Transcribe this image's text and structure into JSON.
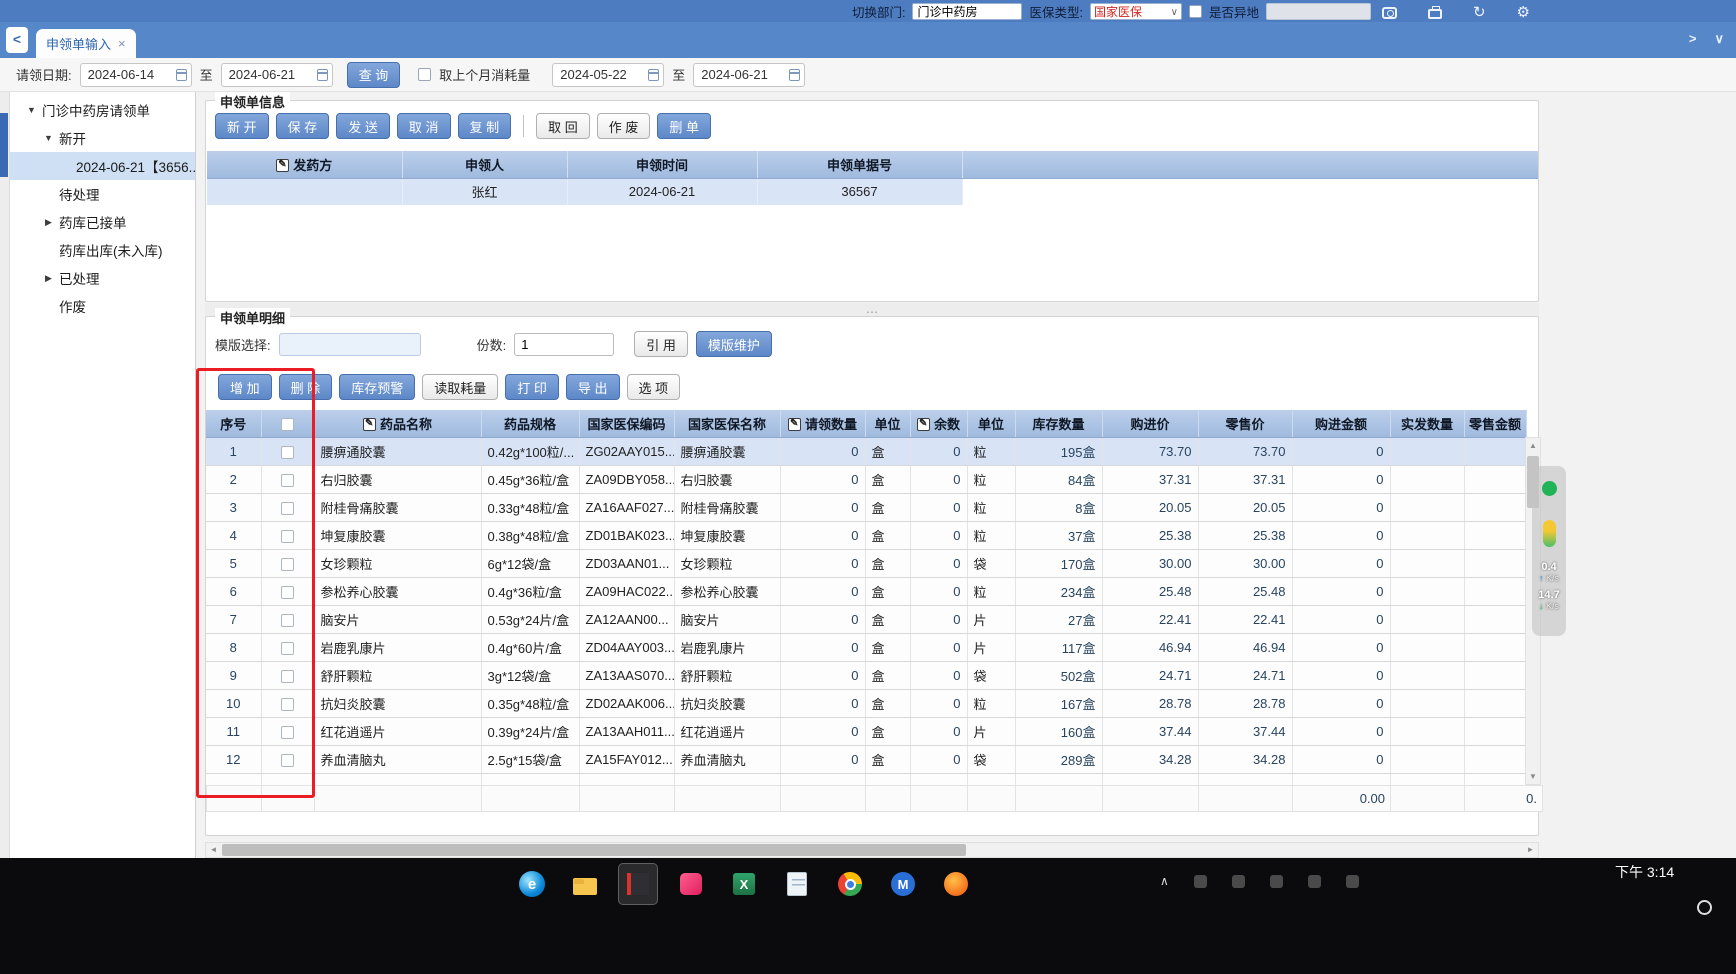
{
  "topbar": {
    "dept_label": "切换部门:",
    "dept_value": "门诊中药房",
    "insurance_label": "医保类型:",
    "insurance_value": "国家医保",
    "remote_label": "是否异地",
    "icons": [
      "screenshot-icon",
      "print-icon",
      "history-icon",
      "settings-gear-icon"
    ]
  },
  "tabbar": {
    "active_tab": "申领单输入"
  },
  "filterbar": {
    "date_label": "请领日期:",
    "date_from": "2024-06-14",
    "to_label": "至",
    "date_to": "2024-06-21",
    "query_button": "查 询",
    "consume_checkbox_label": "取上个月消耗量",
    "consume_from": "2024-05-22",
    "consume_to_label": "至",
    "consume_to": "2024-06-21"
  },
  "sidebar": {
    "items": [
      {
        "label": "门诊中药房请领单",
        "level": 0,
        "arrow": "down"
      },
      {
        "label": "新开",
        "level": 1,
        "arrow": "down"
      },
      {
        "label": "2024-06-21【3656...",
        "level": 2,
        "selected": true
      },
      {
        "label": "待处理",
        "level": 1
      },
      {
        "label": "药库已接单",
        "level": 1,
        "arrow": "right"
      },
      {
        "label": "药库出库(未入库)",
        "level": 1
      },
      {
        "label": "已处理",
        "level": 1,
        "arrow": "right"
      },
      {
        "label": "作废",
        "level": 1
      }
    ]
  },
  "info_section": {
    "title": "申领单信息",
    "buttons_primary": [
      "新 开",
      "保 存",
      "发 送",
      "取 消",
      "复 制"
    ],
    "buttons_secondary": [
      "取 回",
      "作 废"
    ],
    "button_delete": "删 单",
    "table": {
      "columns": [
        {
          "label": "发药方",
          "edit": true
        },
        {
          "label": "申领人"
        },
        {
          "label": "申领时间"
        },
        {
          "label": "申领单据号"
        }
      ],
      "row": [
        "",
        "张红",
        "2024-06-21",
        "36567"
      ]
    }
  },
  "detail_section": {
    "title": "申领单明细",
    "template_label": "模版选择:",
    "copies_label": "份数:",
    "copies_value": "1",
    "cite_button": "引 用",
    "template_maintain_button": "模版维护",
    "toolbar": {
      "add": "增 加",
      "delete": "删 除",
      "stock_warning": "库存预警",
      "read_usage": "读取耗量",
      "print": "打 印",
      "export": "导 出",
      "options": "选 项"
    }
  },
  "grid": {
    "columns": [
      {
        "label": "序号"
      },
      {
        "label": "",
        "checkbox": true
      },
      {
        "label": "药品名称",
        "edit": true
      },
      {
        "label": "药品规格"
      },
      {
        "label": "国家医保编码"
      },
      {
        "label": "国家医保名称"
      },
      {
        "label": "请领数量",
        "edit": true
      },
      {
        "label": "单位"
      },
      {
        "label": "余数",
        "edit": true
      },
      {
        "label": "单位"
      },
      {
        "label": "库存数量"
      },
      {
        "label": "购进价"
      },
      {
        "label": "零售价"
      },
      {
        "label": "购进金额"
      },
      {
        "label": "实发数量"
      },
      {
        "label": "零售金额"
      }
    ],
    "rows": [
      [
        "1",
        "腰痹通胶囊",
        "0.42g*100粒/...",
        "ZG02AAY015...",
        "腰痹通胶囊",
        "0",
        "盒",
        "0",
        "粒",
        "195盒",
        "73.70",
        "73.70",
        "0",
        "",
        ""
      ],
      [
        "2",
        "右归胶囊",
        "0.45g*36粒/盒",
        "ZA09DBY058...",
        "右归胶囊",
        "0",
        "盒",
        "0",
        "粒",
        "84盒",
        "37.31",
        "37.31",
        "0",
        "",
        ""
      ],
      [
        "3",
        "附桂骨痛胶囊",
        "0.33g*48粒/盒",
        "ZA16AAF027...",
        "附桂骨痛胶囊",
        "0",
        "盒",
        "0",
        "粒",
        "8盒",
        "20.05",
        "20.05",
        "0",
        "",
        ""
      ],
      [
        "4",
        "坤复康胶囊",
        "0.38g*48粒/盒",
        "ZD01BAK023...",
        "坤复康胶囊",
        "0",
        "盒",
        "0",
        "粒",
        "37盒",
        "25.38",
        "25.38",
        "0",
        "",
        ""
      ],
      [
        "5",
        "女珍颗粒",
        "6g*12袋/盒",
        "ZD03AAN01...",
        "女珍颗粒",
        "0",
        "盒",
        "0",
        "袋",
        "170盒",
        "30.00",
        "30.00",
        "0",
        "",
        ""
      ],
      [
        "6",
        "参松养心胶囊",
        "0.4g*36粒/盒",
        "ZA09HAC022...",
        "参松养心胶囊",
        "0",
        "盒",
        "0",
        "粒",
        "234盒",
        "25.48",
        "25.48",
        "0",
        "",
        ""
      ],
      [
        "7",
        "脑安片",
        "0.53g*24片/盒",
        "ZA12AAN00...",
        "脑安片",
        "0",
        "盒",
        "0",
        "片",
        "27盒",
        "22.41",
        "22.41",
        "0",
        "",
        ""
      ],
      [
        "8",
        "岩鹿乳康片",
        "0.4g*60片/盒",
        "ZD04AAY003...",
        "岩鹿乳康片",
        "0",
        "盒",
        "0",
        "片",
        "117盒",
        "46.94",
        "46.94",
        "0",
        "",
        ""
      ],
      [
        "9",
        "舒肝颗粒",
        "3g*12袋/盒",
        "ZA13AAS070...",
        "舒肝颗粒",
        "0",
        "盒",
        "0",
        "袋",
        "502盒",
        "24.71",
        "24.71",
        "0",
        "",
        ""
      ],
      [
        "10",
        "抗妇炎胶囊",
        "0.35g*48粒/盒",
        "ZD02AAK006...",
        "抗妇炎胶囊",
        "0",
        "盒",
        "0",
        "粒",
        "167盒",
        "28.78",
        "28.78",
        "0",
        "",
        ""
      ],
      [
        "11",
        "红花逍遥片",
        "0.39g*24片/盒",
        "ZA13AAH011...",
        "红花逍遥片",
        "0",
        "盒",
        "0",
        "片",
        "160盒",
        "37.44",
        "37.44",
        "0",
        "",
        ""
      ],
      [
        "12",
        "养血清脑丸",
        "2.5g*15袋/盒",
        "ZA15FAY012...",
        "养血清脑丸",
        "0",
        "盒",
        "0",
        "袋",
        "289盒",
        "34.28",
        "34.28",
        "0",
        "",
        ""
      ]
    ],
    "footer": {
      "purchase_amount_total": "0.00",
      "sell_amount_total": "0."
    }
  },
  "net_monitor": {
    "up_value": "0.4",
    "up_unit": "K/s",
    "down_value": "14.7",
    "down_unit": "K/s"
  },
  "taskbar": {
    "icons": [
      "windows-logo",
      "edge-browser",
      "file-explorer",
      "his-app-active",
      "pink-app",
      "excel",
      "notepad",
      "chrome",
      "m-app",
      "security-app"
    ],
    "time": "下午 3:14"
  }
}
